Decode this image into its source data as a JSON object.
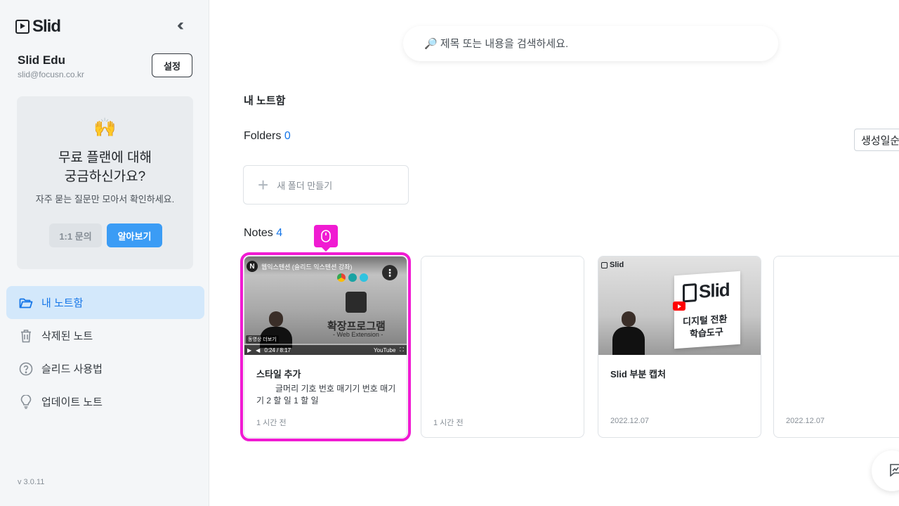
{
  "app": {
    "name": "Slid",
    "version": "v 3.0.11"
  },
  "colors": {
    "accent": "#3b9cf5",
    "highlight": "#f01bd2",
    "active_nav_bg": "#d3e8fb"
  },
  "user": {
    "name": "Slid Edu",
    "email": "slid@focusn.co.kr",
    "settings_label": "설정"
  },
  "promo": {
    "emoji": "🙌",
    "title": "무료 플랜에 대해\n궁금하신가요?",
    "subtitle": "자주 묻는 질문만 모아서 확인하세요.",
    "inquiry_label": "1:1 문의",
    "learn_label": "알아보기"
  },
  "nav": {
    "items": [
      {
        "label": "내 노트함",
        "icon": "folder-icon",
        "active": true
      },
      {
        "label": "삭제된 노트",
        "icon": "trash-icon",
        "active": false
      },
      {
        "label": "슬리드 사용법",
        "icon": "help-icon",
        "active": false
      },
      {
        "label": "업데이트 노트",
        "icon": "lightbulb-icon",
        "active": false
      }
    ]
  },
  "search": {
    "placeholder": "🔎 제목 또는 내용을 검색하세요."
  },
  "main": {
    "title": "내 노트함",
    "folders_label": "Folders",
    "folders_count": "0",
    "sort_label": "생성일순",
    "new_folder_label": "새 폴더 만들기",
    "notes_label": "Notes",
    "notes_count": "4"
  },
  "notes": [
    {
      "title": "스타일 추가",
      "body": "글머리 기호 번호 매기기 번호 매기기 2 할 일 1 할 일",
      "date": "1 시간 전",
      "thumb": {
        "video_title": "웹익스텐션 (슬리드 익스텐션 강좌)",
        "main_text": "확장프로그램",
        "sub_text": "- Web Extension -",
        "time": "0:24 / 8:17",
        "badge": "동영상 더보기",
        "platform": "YouTube"
      }
    },
    {
      "title": "",
      "body": "",
      "date": "1 시간 전"
    },
    {
      "title": "Slid 부분 캡처",
      "body": "",
      "date": "2022.12.07",
      "thumb": {
        "logo_text": "Slid",
        "line1": "디지털 전환",
        "line2": "학습도구"
      }
    },
    {
      "title": "",
      "body": "",
      "date": "2022.12.07"
    }
  ]
}
